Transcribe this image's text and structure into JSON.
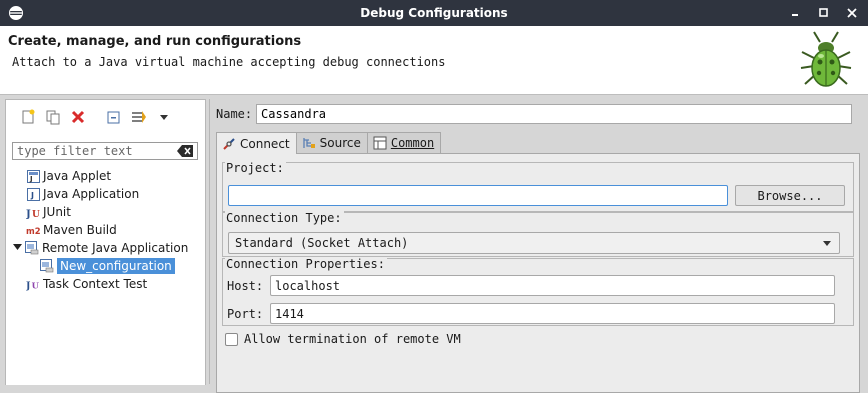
{
  "window": {
    "title": "Debug Configurations",
    "app_icon": "eclipse-icon",
    "buttons": [
      "minimize-icon",
      "maximize-icon",
      "close-icon"
    ]
  },
  "banner": {
    "title": "Create, manage, and run configurations",
    "description": "Attach to a Java virtual machine accepting debug connections",
    "icon": "debug-bug-icon"
  },
  "left": {
    "toolbar": [
      "new-config-icon",
      "duplicate-icon",
      "delete-icon",
      "collapse-all-icon",
      "filter-icon",
      "view-menu-dropdown-icon"
    ],
    "filter": {
      "placeholder": "type filter text",
      "value": ""
    },
    "tree": [
      {
        "label": "Java Applet",
        "icon": "java-applet-icon",
        "level": 0
      },
      {
        "label": "Java Application",
        "icon": "java-application-icon",
        "level": 0
      },
      {
        "label": "JUnit",
        "icon": "junit-icon",
        "level": 0
      },
      {
        "label": "Maven Build",
        "icon": "maven-icon",
        "level": 0
      },
      {
        "label": "Remote Java Application",
        "icon": "remote-java-icon",
        "level": 0,
        "expanded": true
      },
      {
        "label": "New_configuration",
        "icon": "remote-config-icon",
        "level": 1,
        "selected": true
      },
      {
        "label": "Task Context Test",
        "icon": "task-context-icon",
        "level": 0
      }
    ]
  },
  "right": {
    "name_label": "Name:",
    "name_value": "Cassandra",
    "tabs": [
      {
        "label": "Connect",
        "icon": "connect-icon",
        "active": true
      },
      {
        "label": "Source",
        "icon": "source-icon",
        "active": false
      },
      {
        "label": "Common",
        "icon": "common-icon",
        "active": false
      }
    ],
    "project": {
      "group_label": "Project:",
      "value": "",
      "browse_label": "Browse..."
    },
    "connection_type": {
      "group_label": "Connection Type:",
      "selected": "Standard (Socket Attach)"
    },
    "connection_properties": {
      "group_label": "Connection Properties:",
      "host_label": "Host:",
      "host_value": "localhost",
      "port_label": "Port:",
      "port_value": "1414"
    },
    "allow_termination": {
      "label": "Allow termination of remote VM",
      "checked": false
    }
  },
  "colors": {
    "titlebar_bg": "#2f343f",
    "selection": "#4a90d9",
    "panel_bg": "#d6d6d6",
    "delete_red": "#d92b2b"
  }
}
